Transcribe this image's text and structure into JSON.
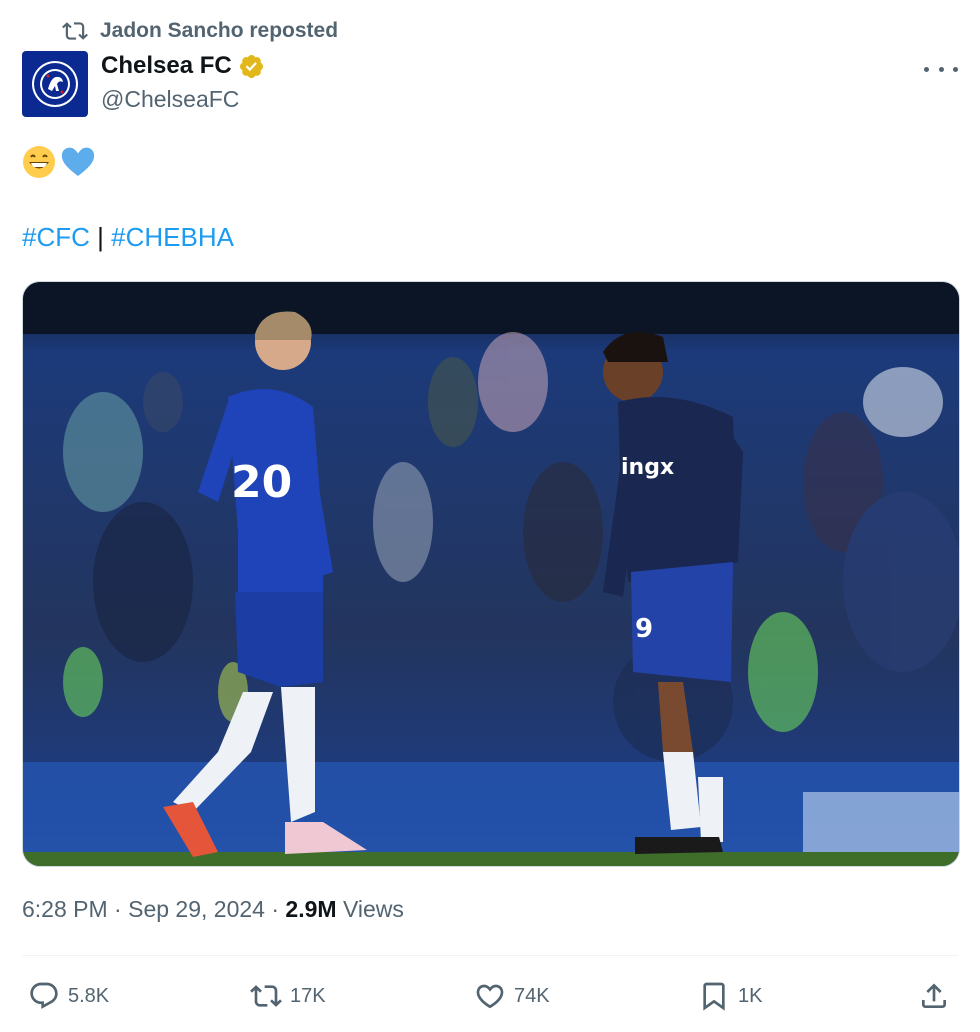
{
  "repost": {
    "text": "Jadon Sancho reposted"
  },
  "author": {
    "name": "Chelsea FC",
    "handle": "@ChelseaFC",
    "verified_color": "#e2b719",
    "avatar_color": "#0a2a92"
  },
  "tweet": {
    "emojis": [
      "grinning-face",
      "blue-heart"
    ],
    "hashtag1": "#CFC",
    "separator": "|",
    "hashtag2": "#CHEBHA"
  },
  "media": {
    "description": "photo"
  },
  "meta": {
    "time": "6:28 PM",
    "dot1": "·",
    "date": "Sep 29, 2024",
    "dot2": "·",
    "views_count": "2.9M",
    "views_label": "Views"
  },
  "actions": {
    "replies": "5.8K",
    "reposts": "17K",
    "likes": "74K",
    "bookmarks": "1K"
  },
  "colors": {
    "link": "#1d9bf0",
    "muted": "#536471",
    "text": "#0f1419"
  }
}
